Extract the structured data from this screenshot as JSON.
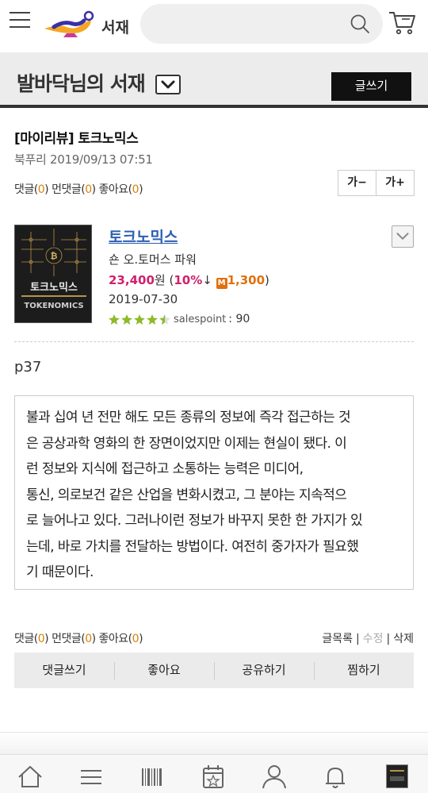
{
  "header": {
    "logo_text": "서재",
    "search_placeholder": ""
  },
  "library": {
    "title": "발바닥님의 서재",
    "write_label": "글쓰기"
  },
  "post": {
    "title": "[마이리뷰] 토크노믹스",
    "author": "북푸리",
    "datetime": "2019/09/13 07:51",
    "stats": {
      "comment_label": "댓글",
      "comment_count": "0",
      "trackback_label": "먼댓글",
      "trackback_count": "0",
      "like_label": "좋아요",
      "like_count": "0"
    },
    "font_decrease_label": "가−",
    "font_increase_label": "가+",
    "page_label": "p37",
    "quote_lines": [
      "불과 십여 년 전만 해도 모든 종류의 정보에 즉각 접근하는 것",
      "은 공상과학 영화의 한 장면이었지만 이제는 현실이 됐다. 이",
      "런 정보와 지식에 접근하고 소통하는 능력은 미디어,",
      "통신, 의로보건 같은 산업을 변화시켰고, 그 분야는 지속적으",
      "로 늘어나고 있다. 그러나이런 정보가 바꾸지 못한 한 가지가 있",
      "는데, 바로 가치를 전달하는 방법이다. 여전히 중가자가 필요했",
      "기 때문이다."
    ]
  },
  "book": {
    "title": "토크노믹스",
    "author": "숀 오.토머스 파워",
    "price": "23,400",
    "price_unit": "원",
    "discount": "10%",
    "mileage": "1,300",
    "pub_date": "2019-07-30",
    "rating_stars": 4.5,
    "salespoint_label": "salespoint",
    "salespoint_value": ": 90",
    "cover_title": "토크노믹스",
    "cover_subtitle": "TOKENOMICS"
  },
  "footer": {
    "list_label": "글목록",
    "edit_label": "수정",
    "delete_label": "삭제",
    "actions": [
      "댓글쓰기",
      "좋아요",
      "공유하기",
      "찜하기"
    ]
  },
  "colors": {
    "accent_number": "#d98200",
    "price": "#d0206b",
    "link": "#2c5fb3"
  }
}
